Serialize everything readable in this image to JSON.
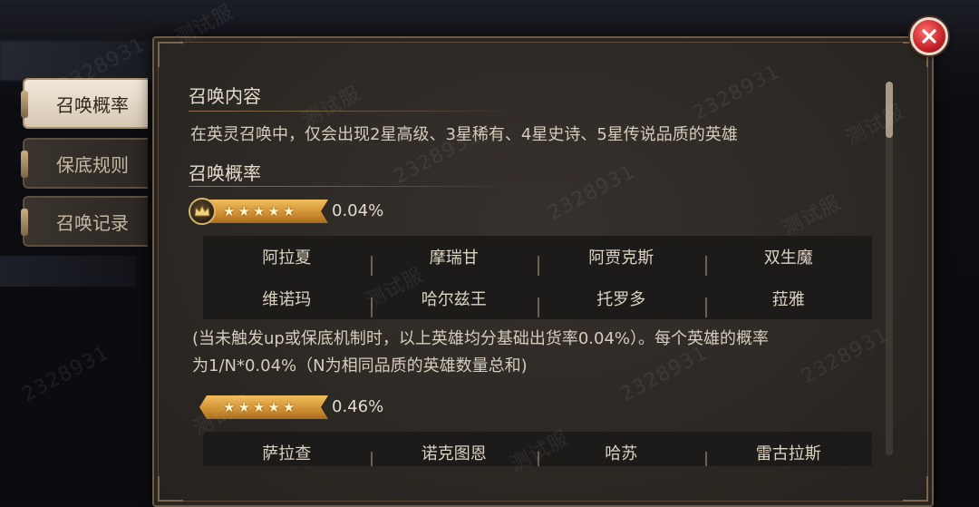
{
  "tabs": [
    {
      "label": "召唤概率",
      "active": true
    },
    {
      "label": "保底规则",
      "active": false
    },
    {
      "label": "召唤记录",
      "active": false
    }
  ],
  "close_icon": "close-icon",
  "content": {
    "section1_title": "召唤内容",
    "section1_desc": "在英灵召唤中，仅会出现2星高级、3星稀有、4星史诗、5星传说品质的英雄",
    "section2_title": "召唤概率",
    "groups": [
      {
        "stars": 5,
        "crown": true,
        "rate": "0.04%",
        "heroes": [
          [
            "阿拉夏",
            "摩瑞甘",
            "阿贾克斯",
            "双生魔"
          ],
          [
            "维诺玛",
            "哈尔兹王",
            "托罗多",
            "菈雅"
          ]
        ]
      },
      {
        "stars": 5,
        "crown": false,
        "rate": "0.46%",
        "heroes": [
          [
            "萨拉查",
            "诺克图恩",
            "哈苏",
            "雷古拉斯"
          ]
        ]
      }
    ],
    "note_line1": "(当未触发up或保底机制时，以上英雄均分基础出货率0.04%）。每个英雄的概率",
    "note_line2": "为1/N*0.04%（N为相同品质的英雄数量总和)"
  },
  "watermark": {
    "id": "2328931",
    "tag": "测试服"
  },
  "colors": {
    "ribbon": "#d99a3c",
    "panel": "#2f2b27",
    "close": "#d0262c"
  }
}
